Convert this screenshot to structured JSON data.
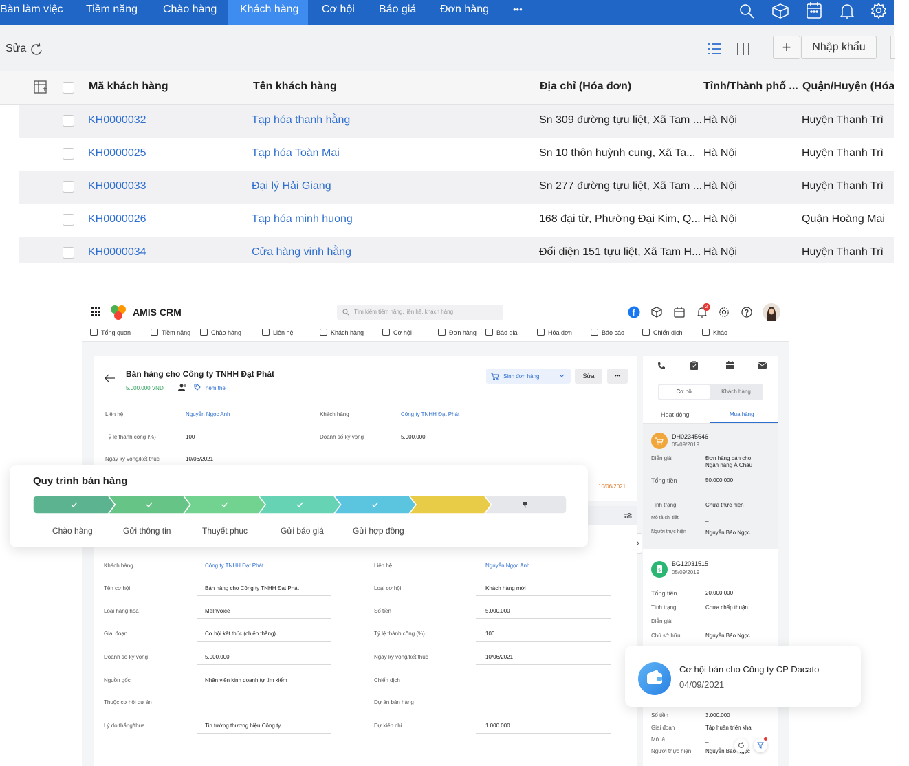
{
  "top": {
    "nav": [
      {
        "label": "Bàn làm việc",
        "active": false
      },
      {
        "label": "Tiềm năng",
        "active": false
      },
      {
        "label": "Chào hàng",
        "active": false
      },
      {
        "label": "Khách hàng",
        "active": true
      },
      {
        "label": "Cơ hội",
        "active": false
      },
      {
        "label": "Báo giá",
        "active": false
      },
      {
        "label": "Đơn hàng",
        "active": false
      },
      {
        "label": "•••",
        "active": false
      }
    ],
    "toolbar": {
      "edit_label": "Sửa",
      "import_label": "Nhập khẩu",
      "add_symbol": "+"
    },
    "table": {
      "headers": [
        "Mã khách hàng",
        "Tên khách hàng",
        "Địa chỉ (Hóa đơn)",
        "Tỉnh/Thành phố ...",
        "Quận/Huyện (Hóa đ"
      ],
      "rows": [
        {
          "code": "KH0000032",
          "name": "Tạp hóa thanh hằng",
          "address": "Sn 309 đường tựu liệt, Xã Tam ...",
          "city": "Hà Nội",
          "district": "Huyện Thanh Trì"
        },
        {
          "code": "KH0000025",
          "name": "Tạp hóa Toàn Mai",
          "address": "Sn 10 thôn huỳnh cung, Xã Ta...",
          "city": "Hà Nội",
          "district": "Huyện Thanh Trì"
        },
        {
          "code": "KH0000033",
          "name": "Đại lý Hải Giang",
          "address": "Sn 277 đường tựu liệt, Xã Tam ...",
          "city": "Hà Nội",
          "district": "Huyện Thanh Trì"
        },
        {
          "code": "KH0000026",
          "name": "Tạp hóa minh huong",
          "address": "168 đại từ, Phường Đại Kim, Q...",
          "city": "Hà Nội",
          "district": "Quận Hoàng Mai"
        },
        {
          "code": "KH0000034",
          "name": "Cửa hàng vinh hằng",
          "address": "Đối diện 151 tựu liệt, Xã Tam H...",
          "city": "Hà Nội",
          "district": "Huyện Thanh Trì"
        }
      ]
    }
  },
  "crm": {
    "app_name": "AMIS CRM",
    "search_placeholder": "Tìm kiếm tiềm năng, liên hệ, khách hàng",
    "notification_count": "2",
    "nav": [
      "Tổng quan",
      "Tiềm năng",
      "Chào hàng",
      "Liên hệ",
      "Khách hàng",
      "Cơ hội",
      "Đơn hàng",
      "Báo giá",
      "Hóa đơn",
      "Báo cáo",
      "Chiến dịch",
      "Khác"
    ],
    "record": {
      "title": "Bán hàng cho Công ty TNHH Đạt Phát",
      "amount": "5.000.000",
      "currency": "VND",
      "add_tag": "Thêm thẻ",
      "btn_order": "Sinh đơn hàng",
      "btn_edit": "Sửa",
      "btn_more": "•••",
      "summary": [
        {
          "label": "Liên hệ",
          "value": "Nguyễn Ngọc Anh"
        },
        {
          "label": "Khách hàng",
          "value": "Công ty TNHH Đạt Phát"
        },
        {
          "label": "Tỷ lệ thành công (%)",
          "value": "100"
        },
        {
          "label": "Doanh số kỳ vọng",
          "value": "5.000.000"
        },
        {
          "label": "Ngày kỳ vọng/kết thúc",
          "value": "10/06/2021"
        }
      ],
      "date_right": "10/06/2021",
      "details_left": [
        {
          "label": "Khách hàng",
          "value": "Công ty TNHH Đạt Phát"
        },
        {
          "label": "Tên cơ hội",
          "value": "Bán hàng cho Công ty TNHH Đạt Phát"
        },
        {
          "label": "Loại hàng hóa",
          "value": "MeInvoice"
        },
        {
          "label": "Giai đoạn",
          "value": "Cơ hội kết thúc (chiến thắng)"
        },
        {
          "label": "Doanh số kỳ vọng",
          "value": "5.000.000"
        },
        {
          "label": "Nguồn gốc",
          "value": "Nhân viên kinh doanh tự tìm kiếm"
        },
        {
          "label": "Thuộc cơ hội dự án",
          "value": "_"
        },
        {
          "label": "Lý do thắng/thua",
          "value": "Tin tưởng thương hiệu Công ty"
        }
      ],
      "details_right": [
        {
          "label": "Liên hệ",
          "value": "Nguyễn Ngọc Anh"
        },
        {
          "label": "Loại cơ hội",
          "value": "Khách hàng mới"
        },
        {
          "label": "Số tiền",
          "value": "5.000.000"
        },
        {
          "label": "Tỷ lệ thành công (%)",
          "value": "100"
        },
        {
          "label": "Ngày kỳ vọng/kết thúc",
          "value": "10/06/2021"
        },
        {
          "label": "Chiến dịch",
          "value": "_"
        },
        {
          "label": "Dự án bán hàng",
          "value": "_"
        },
        {
          "label": "Dự kiến chi",
          "value": "1.000.000"
        }
      ]
    },
    "side": {
      "tabs": [
        "Cơ hội",
        "Khách hàng"
      ],
      "subtabs": [
        "Hoạt động",
        "Mua hàng"
      ],
      "items": [
        {
          "code": "DH02345646",
          "date": "05/09/2019",
          "fields": [
            {
              "label": "Diễn giải",
              "value": "Đơn hàng bán cho Ngân hàng Á Châu"
            },
            {
              "label": "Tổng tiền",
              "value": "50.000.000"
            },
            {
              "label": "Tình trạng",
              "value": "Chưa thực hiện"
            },
            {
              "label": "Mô tả chi tiết",
              "value": "_"
            },
            {
              "label": "Người thực hiện",
              "value": "Nguyễn Bảo Ngọc"
            }
          ]
        },
        {
          "code": "BG12031515",
          "date": "05/09/2019",
          "fields": [
            {
              "label": "Tổng tiền",
              "value": "20.000.000"
            },
            {
              "label": "Tình trạng",
              "value": "Chưa chấp thuận"
            },
            {
              "label": "Diễn giải",
              "value": "_"
            },
            {
              "label": "Chủ sở hữu",
              "value": "Nguyễn Bảo Ngọc"
            }
          ]
        }
      ],
      "bottom_fields": [
        {
          "label": "Số tiền",
          "value": "3.000.000"
        },
        {
          "label": "Giai đoạn",
          "value": "Tập huấn triển khai"
        },
        {
          "label": "Mô tả",
          "value": "_"
        },
        {
          "label": "Người thực hiện",
          "value": "Nguyễn Bảo Ngọc"
        }
      ]
    }
  },
  "process": {
    "title": "Quy trình bán hàng",
    "stages": [
      "Chào hàng",
      "Gửi thông tin",
      "Thuyết phục",
      "Gửi báo giá",
      "Gửi hợp đồng"
    ],
    "colors": [
      "#5bb38f",
      "#66c486",
      "#72d391",
      "#66d3b5",
      "#5bc4df",
      "#e8cc48",
      "#e6e7ea"
    ]
  },
  "toast": {
    "title": "Cơ hội bán cho Công ty CP Dacato",
    "date": "04/09/2021"
  }
}
